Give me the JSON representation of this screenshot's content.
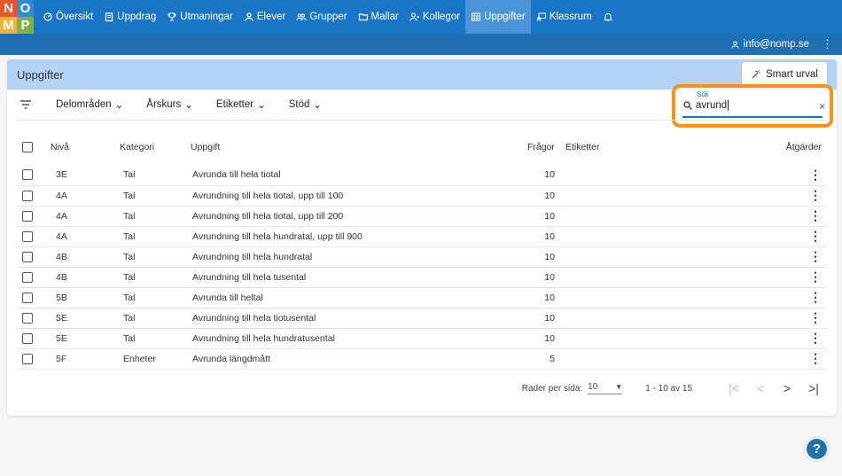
{
  "logo": {
    "letters": [
      "N",
      "O",
      "M",
      "P"
    ]
  },
  "nav": {
    "items": [
      {
        "label": "Översikt",
        "icon": "dashboard-icon"
      },
      {
        "label": "Uppdrag",
        "icon": "clipboard-icon"
      },
      {
        "label": "Utmaningar",
        "icon": "trophy-icon"
      },
      {
        "label": "Elever",
        "icon": "person-icon"
      },
      {
        "label": "Grupper",
        "icon": "group-icon"
      },
      {
        "label": "Mallar",
        "icon": "folder-icon"
      },
      {
        "label": "Kollegor",
        "icon": "colleagues-icon"
      },
      {
        "label": "Uppgifter",
        "icon": "grid-icon",
        "active": true
      },
      {
        "label": "Klassrum",
        "icon": "classroom-icon"
      }
    ],
    "bell_icon": "bell-icon"
  },
  "user": {
    "email": "info@nomp.se"
  },
  "card": {
    "title": "Uppgifter",
    "smart_label": "Smart urval"
  },
  "filters": {
    "items": [
      "Delområden",
      "Årskurs",
      "Etiketter",
      "Stöd"
    ]
  },
  "search": {
    "label": "Sök",
    "value": "avrund"
  },
  "table": {
    "headers": {
      "level": "Nivå",
      "category": "Kategori",
      "task": "Uppgift",
      "questions": "Frågor",
      "tags": "Etiketter",
      "actions": "Åtgärder"
    },
    "rows": [
      {
        "level": "3E",
        "category": "Tal",
        "task": "Avrunda till hela tiotal",
        "questions": "10",
        "tags": ""
      },
      {
        "level": "4A",
        "category": "Tal",
        "task": "Avrundning till hela tiotal, upp till 100",
        "questions": "10",
        "tags": ""
      },
      {
        "level": "4A",
        "category": "Tal",
        "task": "Avrundning till hela tiotal, upp till 200",
        "questions": "10",
        "tags": ""
      },
      {
        "level": "4A",
        "category": "Tal",
        "task": "Avrundning till hela hundratal, upp till 900",
        "questions": "10",
        "tags": ""
      },
      {
        "level": "4B",
        "category": "Tal",
        "task": "Avrundning till hela hundratal",
        "questions": "10",
        "tags": ""
      },
      {
        "level": "4B",
        "category": "Tal",
        "task": "Avrundning till hela tusental",
        "questions": "10",
        "tags": ""
      },
      {
        "level": "5B",
        "category": "Tal",
        "task": "Avrunda till heltal",
        "questions": "10",
        "tags": ""
      },
      {
        "level": "5E",
        "category": "Tal",
        "task": "Avrundning till hela tiotusental",
        "questions": "10",
        "tags": ""
      },
      {
        "level": "5E",
        "category": "Tal",
        "task": "Avrundning till hela hundratusental",
        "questions": "10",
        "tags": ""
      },
      {
        "level": "5F",
        "category": "Enheter",
        "task": "Avrunda längdmått",
        "questions": "5",
        "tags": ""
      }
    ]
  },
  "pagination": {
    "rows_label": "Rader per sida:",
    "rows_value": "10",
    "range": "1 - 10 av 15"
  },
  "help": {
    "label": "?"
  },
  "colors": {
    "nav": "#1976c7",
    "subbar": "#1f6fb3",
    "highlight": "#f0941d",
    "cardhead": "#b3d4f5"
  }
}
